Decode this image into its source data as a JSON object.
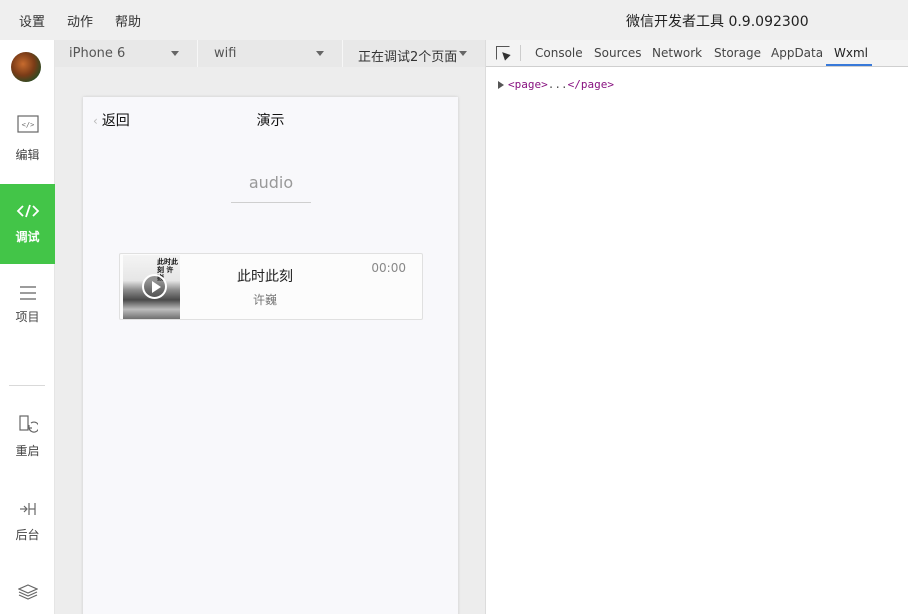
{
  "menubar": {
    "items": [
      "设置",
      "动作",
      "帮助"
    ],
    "app_title": "微信开发者工具 0.9.092300"
  },
  "sidebar": {
    "items": [
      {
        "label": "编辑",
        "icon": "code-editor-icon"
      },
      {
        "label": "调试",
        "icon": "debug-code-icon",
        "active": true
      },
      {
        "label": "项目",
        "icon": "menu-icon"
      },
      {
        "label": "重启",
        "icon": "restart-icon"
      },
      {
        "label": "后台",
        "icon": "background-icon"
      },
      {
        "label": "",
        "icon": "layers-icon"
      }
    ],
    "accent_color": "#43c548"
  },
  "sim_toolbar": {
    "device": "iPhone 6",
    "network": "wifi",
    "debug_status": "正在调试2个页面"
  },
  "phone": {
    "back_label": "返回",
    "nav_title": "演示",
    "page_heading": "audio",
    "audio": {
      "name": "此时此刻",
      "author": "许巍",
      "time": "00:00",
      "cover_text": "此时此刻 许巍"
    }
  },
  "devtools": {
    "tabs": [
      "Console",
      "Sources",
      "Network",
      "Storage",
      "AppData",
      "Wxml"
    ],
    "active_tab": "Wxml",
    "tree": {
      "open_tag": "<page>",
      "ellipsis": "...",
      "close_tag": "</page>"
    }
  }
}
